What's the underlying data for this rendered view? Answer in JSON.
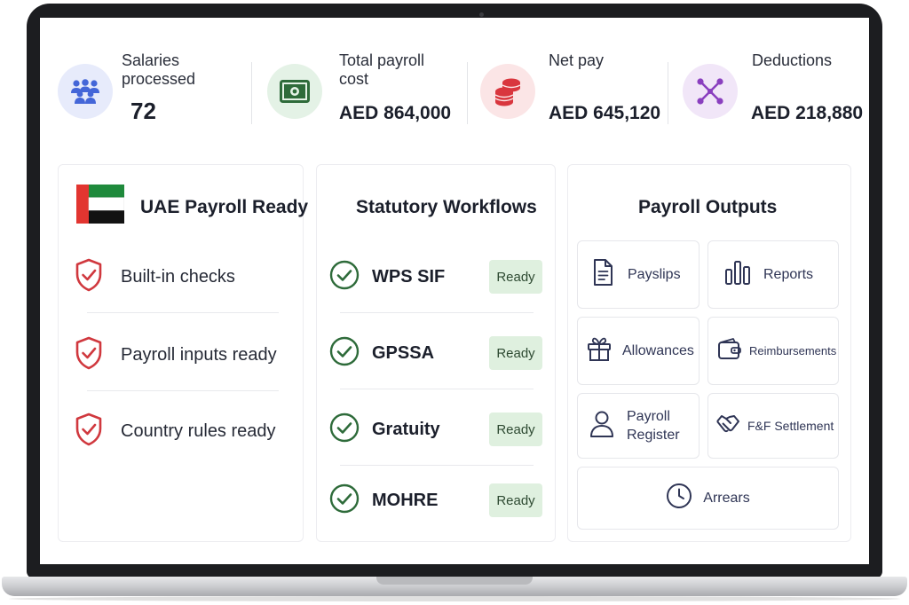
{
  "stats": {
    "salaries": {
      "label_line1": "Salaries",
      "label_line2": "processed",
      "value": "72",
      "icon": "people-group-icon",
      "bg": "#e7ebfb",
      "color": "#4466d8"
    },
    "total_cost": {
      "label_line1": "Total payroll",
      "label_line2": "cost",
      "value": "AED 864,000",
      "icon": "banknote-icon",
      "bg": "#e4f2e6",
      "color": "#2e6b3a"
    },
    "net_pay": {
      "label": "Net pay",
      "value": "AED 645,120",
      "icon": "coin-stack-icon",
      "bg": "#fbe5e6",
      "color": "#d9363e"
    },
    "deductions": {
      "label": "Deductions",
      "value": "AED 218,880",
      "icon": "network-x-icon",
      "bg": "#f1e6f8",
      "color": "#8a3fbf"
    }
  },
  "uae_panel": {
    "title": "UAE Payroll Ready",
    "flag_icon": "uae-flag-icon",
    "items": [
      {
        "label": "Built-in checks",
        "icon": "shield-check-icon"
      },
      {
        "label": "Payroll inputs ready",
        "icon": "shield-check-icon"
      },
      {
        "label": "Country rules ready",
        "icon": "shield-check-icon"
      }
    ],
    "accent": "#d0383e"
  },
  "workflows": {
    "title": "Statutory Workflows",
    "items": [
      {
        "label": "WPS SIF",
        "status": "Ready"
      },
      {
        "label": "GPSSA",
        "status": "Ready"
      },
      {
        "label": "Gratuity",
        "status": "Ready"
      },
      {
        "label": "MOHRE",
        "status": "Ready"
      }
    ],
    "check_color": "#2e6b3a"
  },
  "outputs": {
    "title": "Payroll Outputs",
    "tiles": [
      {
        "label": "Payslips",
        "icon": "document-icon"
      },
      {
        "label": "Reports",
        "icon": "bar-chart-icon"
      },
      {
        "label": "Allowances",
        "icon": "gift-icon"
      },
      {
        "label": "Reimbursements",
        "icon": "wallet-icon"
      },
      {
        "label_line1": "Payroll",
        "label_line2": "Register",
        "icon": "user-icon"
      },
      {
        "label": "F&F Settlement",
        "icon": "handshake-icon"
      },
      {
        "label": "Arrears",
        "icon": "clock-icon"
      }
    ],
    "icon_color": "#2f3555"
  }
}
